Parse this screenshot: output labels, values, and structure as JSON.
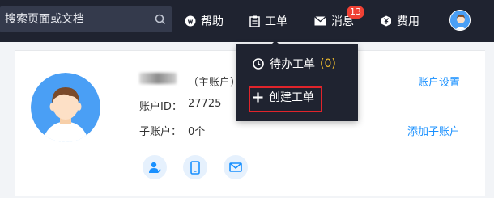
{
  "topbar": {
    "search_placeholder": "搜索页面或文档",
    "help": "帮助",
    "order": "工单",
    "messages": "消息",
    "message_count": "13",
    "fees": "费用"
  },
  "dropdown": {
    "pending_label": "待办工单",
    "pending_count": "(0)",
    "create_label": "创建工单"
  },
  "account": {
    "main_account_tag": "（主账户）",
    "id_label": "账户ID：",
    "id_value": "27725",
    "sub_label": "子账户：",
    "sub_value": "0个",
    "settings_link": "账户设置",
    "add_sub_link": "添加子账户"
  },
  "colors": {
    "topbar": "#1f2330",
    "link": "#1890ff",
    "highlight": "#e0242b",
    "count": "#f5c12e"
  }
}
